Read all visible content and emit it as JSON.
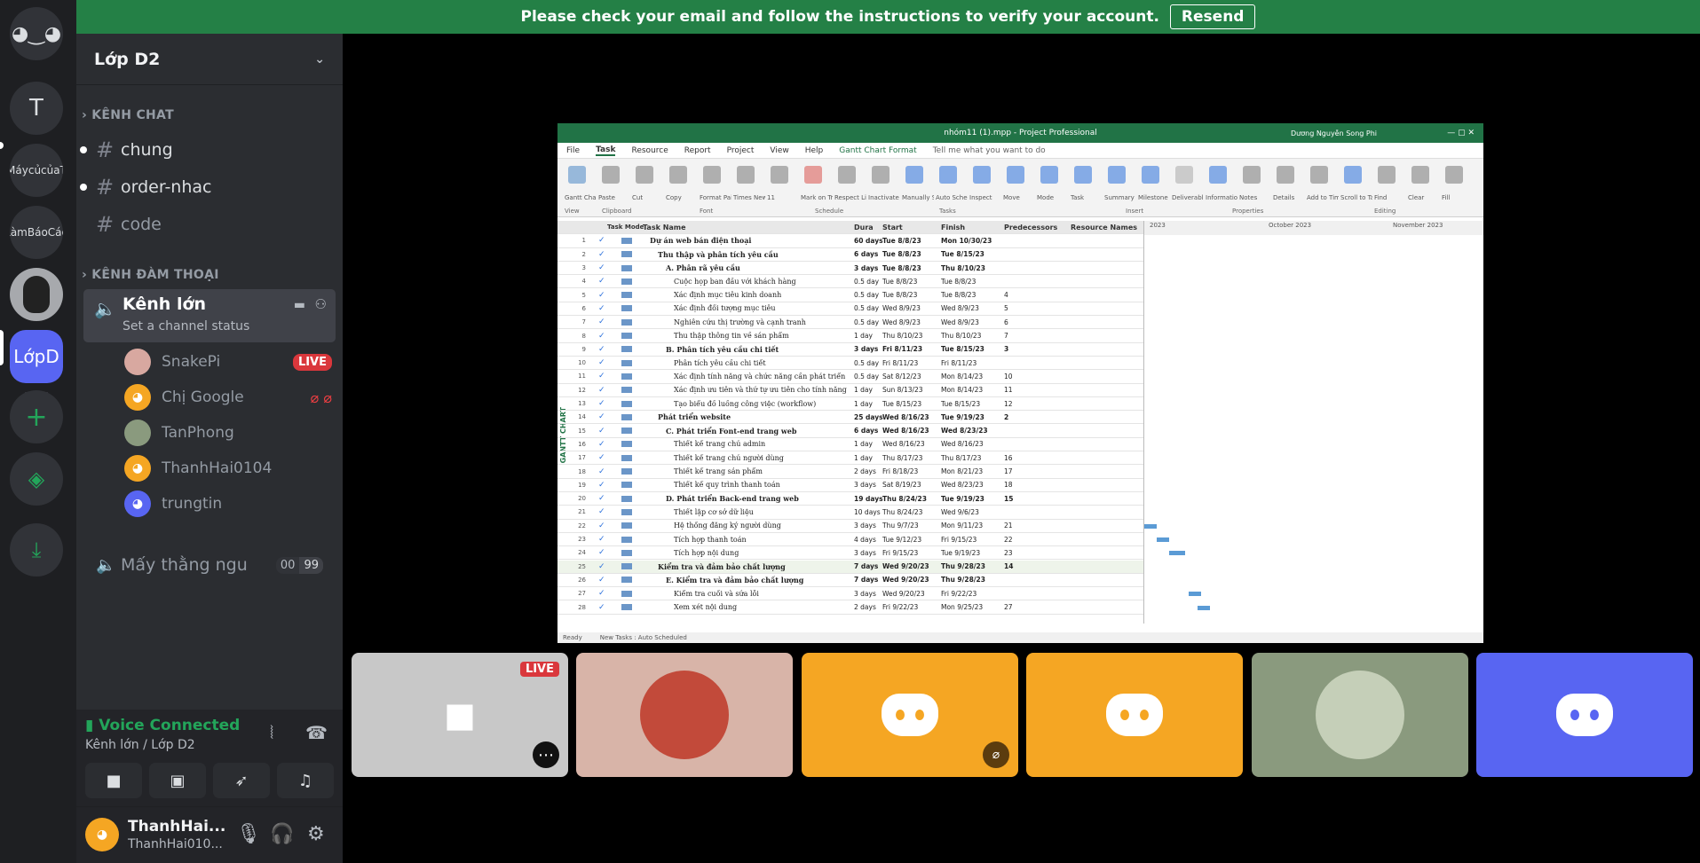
{
  "banner": {
    "text": "Please check your email and follow the instructions to verify your account.",
    "button": "Resend",
    "color": "#248046"
  },
  "servers": [
    {
      "label": "",
      "icon": "discord-icon"
    },
    {
      "label": "T"
    },
    {
      "label": "MáycủcủaT"
    },
    {
      "label": "LàmBáoCáo"
    },
    {
      "label": ""
    },
    {
      "label": "LớpD"
    },
    {
      "label": "+",
      "icon": "add-server-icon"
    },
    {
      "label": "",
      "icon": "explore-icon"
    },
    {
      "label": "",
      "icon": "download-icon"
    }
  ],
  "guild": {
    "name": "Lớp D2"
  },
  "categories": {
    "text": "KÊNH CHAT",
    "voice": "KÊNH ĐÀM THOẠI"
  },
  "text_channels": [
    {
      "name": "chung"
    },
    {
      "name": "order-nhac"
    },
    {
      "name": "code"
    }
  ],
  "voice_channel": {
    "name": "Kênh lớn",
    "status": "Set a channel status"
  },
  "voice_users": [
    {
      "name": "SnakePi",
      "badge": "LIVE",
      "color": "#d8a8a0"
    },
    {
      "name": "Chị Google",
      "color": "#f5a623"
    },
    {
      "name": "TanPhong",
      "color": "#8a9a7e"
    },
    {
      "name": "ThanhHai0104",
      "color": "#f5a623"
    },
    {
      "name": "trungtin",
      "color": "#5865f2"
    }
  ],
  "voice_channel2": {
    "name": "Mấy thằng ngu",
    "count_left": "00",
    "count_right": "99"
  },
  "voice_panel": {
    "status": "Voice Connected",
    "location": "Kênh lớn / Lớp D2"
  },
  "user": {
    "display": "ThanhHai...",
    "tag": "ThanhHai010..."
  },
  "stream": {
    "title": "nhóm11 (1).mpp - Project Professional",
    "user": "Dương Nguyễn Song Phi",
    "menu": [
      "File",
      "Task",
      "Resource",
      "Report",
      "Project",
      "View",
      "Help",
      "Gantt Chart Format"
    ],
    "tell": "Tell me what you want to do",
    "ribbon": [
      "Gantt Chart",
      "Paste",
      "Cut",
      "Copy",
      "Format Painter",
      "Times New Ro",
      "11",
      "Mark on Track",
      "Respect Links",
      "Inactivate",
      "Manually Schedule",
      "Auto Schedule",
      "Inspect",
      "Move",
      "Mode",
      "Task",
      "Summary",
      "Milestone",
      "Deliverable",
      "Information",
      "Notes",
      "Details",
      "Add to Timeline",
      "Scroll to Task",
      "Find",
      "Clear",
      "Fill"
    ],
    "groups": [
      "View",
      "Clipboard",
      "Font",
      "Schedule",
      "Tasks",
      "Insert",
      "Properties",
      "Editing"
    ],
    "headers": {
      "mode": "Task Mode",
      "name": "Task Name",
      "dur": "Dura",
      "start": "Start",
      "finish": "Finish",
      "pred": "Predecessors",
      "res": "Resource Names"
    },
    "timescale": [
      "2023",
      "October 2023",
      "November 2023"
    ],
    "side_label": "GANTT CHART",
    "status": [
      "Ready",
      "New Tasks : Auto Scheduled"
    ],
    "rows": [
      {
        "id": "1",
        "name": "Dự án web bán điện thoại",
        "dur": "60 days",
        "start": "Tue 8/8/23",
        "fin": "Mon 10/30/23",
        "pred": "",
        "lvl": 0,
        "bold": true
      },
      {
        "id": "2",
        "name": "Thu thập và phân tích yêu cầu",
        "dur": "6 days",
        "start": "Tue 8/8/23",
        "fin": "Tue 8/15/23",
        "pred": "",
        "lvl": 1,
        "bold": true
      },
      {
        "id": "3",
        "name": "A. Phân rã yêu cầu",
        "dur": "3 days",
        "start": "Tue 8/8/23",
        "fin": "Thu 8/10/23",
        "pred": "",
        "lvl": 2,
        "bold": true
      },
      {
        "id": "4",
        "name": "Cuộc họp ban đầu với khách hàng",
        "dur": "0.5 day",
        "start": "Tue 8/8/23",
        "fin": "Tue 8/8/23",
        "pred": "",
        "lvl": 3
      },
      {
        "id": "5",
        "name": "Xác định mục tiêu kinh doanh",
        "dur": "0.5 day",
        "start": "Tue 8/8/23",
        "fin": "Tue 8/8/23",
        "pred": "4",
        "lvl": 3
      },
      {
        "id": "6",
        "name": "Xác định đối tượng mục tiêu",
        "dur": "0.5 day",
        "start": "Wed 8/9/23",
        "fin": "Wed 8/9/23",
        "pred": "5",
        "lvl": 3
      },
      {
        "id": "7",
        "name": "Nghiên cứu thị trường và cạnh tranh",
        "dur": "0.5 day",
        "start": "Wed 8/9/23",
        "fin": "Wed 8/9/23",
        "pred": "6",
        "lvl": 3
      },
      {
        "id": "8",
        "name": "Thu thập thông tin về sản phẩm",
        "dur": "1 day",
        "start": "Thu 8/10/23",
        "fin": "Thu 8/10/23",
        "pred": "7",
        "lvl": 3
      },
      {
        "id": "9",
        "name": "B. Phân tích yêu cầu chi tiết",
        "dur": "3 days",
        "start": "Fri 8/11/23",
        "fin": "Tue 8/15/23",
        "pred": "3",
        "lvl": 2,
        "bold": true
      },
      {
        "id": "10",
        "name": "Phân tích yêu cầu chi tiết",
        "dur": "0.5 day",
        "start": "Fri 8/11/23",
        "fin": "Fri 8/11/23",
        "pred": "",
        "lvl": 3
      },
      {
        "id": "11",
        "name": "Xác định tính năng và chức năng cần phát triển",
        "dur": "0.5 day",
        "start": "Sat 8/12/23",
        "fin": "Mon 8/14/23",
        "pred": "10",
        "lvl": 3
      },
      {
        "id": "12",
        "name": "Xác định ưu tiên và thứ tự ưu tiên cho tính năng",
        "dur": "1 day",
        "start": "Sun 8/13/23",
        "fin": "Mon 8/14/23",
        "pred": "11",
        "lvl": 3
      },
      {
        "id": "13",
        "name": "Tạo biểu đồ luồng công việc (workflow)",
        "dur": "1 day",
        "start": "Tue 8/15/23",
        "fin": "Tue 8/15/23",
        "pred": "12",
        "lvl": 3
      },
      {
        "id": "14",
        "name": "Phát triển website",
        "dur": "25 days",
        "start": "Wed 8/16/23",
        "fin": "Tue 9/19/23",
        "pred": "2",
        "lvl": 1,
        "bold": true
      },
      {
        "id": "15",
        "name": "C. Phát triển Font-end trang web",
        "dur": "6 days",
        "start": "Wed 8/16/23",
        "fin": "Wed 8/23/23",
        "pred": "",
        "lvl": 2,
        "bold": true
      },
      {
        "id": "16",
        "name": "Thiết kế trang chủ admin",
        "dur": "1 day",
        "start": "Wed 8/16/23",
        "fin": "Wed 8/16/23",
        "pred": "",
        "lvl": 3
      },
      {
        "id": "17",
        "name": "Thiết kế trang chủ người dùng",
        "dur": "1 day",
        "start": "Thu 8/17/23",
        "fin": "Thu 8/17/23",
        "pred": "16",
        "lvl": 3
      },
      {
        "id": "18",
        "name": "Thiết kế trang sản phẩm",
        "dur": "2 days",
        "start": "Fri 8/18/23",
        "fin": "Mon 8/21/23",
        "pred": "17",
        "lvl": 3
      },
      {
        "id": "19",
        "name": "Thiết kế quy trình thanh toán",
        "dur": "3 days",
        "start": "Sat 8/19/23",
        "fin": "Wed 8/23/23",
        "pred": "18",
        "lvl": 3
      },
      {
        "id": "20",
        "name": "D. Phát triển Back-end trang web",
        "dur": "19 days",
        "start": "Thu 8/24/23",
        "fin": "Tue 9/19/23",
        "pred": "15",
        "lvl": 2,
        "bold": true
      },
      {
        "id": "21",
        "name": "Thiết lập cơ sở dữ liệu",
        "dur": "10 days",
        "start": "Thu 8/24/23",
        "fin": "Wed 9/6/23",
        "pred": "",
        "lvl": 3
      },
      {
        "id": "22",
        "name": "Hệ thống đăng ký người dùng",
        "dur": "3 days",
        "start": "Thu 9/7/23",
        "fin": "Mon 9/11/23",
        "pred": "21",
        "lvl": 3
      },
      {
        "id": "23",
        "name": "Tích hợp thanh toán",
        "dur": "4 days",
        "start": "Tue 9/12/23",
        "fin": "Fri 9/15/23",
        "pred": "22",
        "lvl": 3
      },
      {
        "id": "24",
        "name": "Tích hợp nội dung",
        "dur": "3 days",
        "start": "Fri 9/15/23",
        "fin": "Tue 9/19/23",
        "pred": "23",
        "lvl": 3
      },
      {
        "id": "25",
        "name": "Kiểm tra và đảm bảo chất lượng",
        "dur": "7 days",
        "start": "Wed 9/20/23",
        "fin": "Thu 9/28/23",
        "pred": "14",
        "lvl": 1,
        "bold": true
      },
      {
        "id": "26",
        "name": "E. Kiểm tra và đảm bảo chất lượng",
        "dur": "7 days",
        "start": "Wed 9/20/23",
        "fin": "Thu 9/28/23",
        "pred": "",
        "lvl": 2,
        "bold": true
      },
      {
        "id": "27",
        "name": "Kiểm tra cuối và sửa lỗi",
        "dur": "3 days",
        "start": "Wed 9/20/23",
        "fin": "Fri 9/22/23",
        "pred": "",
        "lvl": 3
      },
      {
        "id": "28",
        "name": "Xem xét nội dung",
        "dur": "2 days",
        "start": "Fri 9/22/23",
        "fin": "Mon 9/25/23",
        "pred": "27",
        "lvl": 3
      }
    ]
  },
  "tiles": [
    {
      "type": "stream",
      "badge": "LIVE"
    },
    {
      "type": "avatar",
      "color": "#d8b4a8"
    },
    {
      "type": "discord",
      "color": "#f5a623"
    },
    {
      "type": "discord",
      "color": "#f5a623"
    },
    {
      "type": "avatar",
      "color": "#8a9a7e"
    },
    {
      "type": "discord",
      "color": "#5865f2"
    }
  ]
}
